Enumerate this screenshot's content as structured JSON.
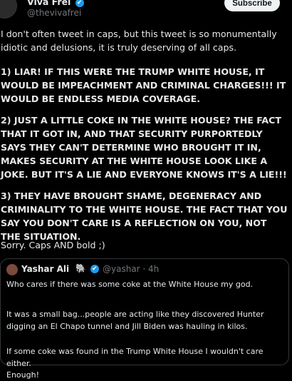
{
  "author": {
    "name": "Viva Frei",
    "verified_badge": "✔",
    "handle": "@thevivafrei",
    "subscribe_label": "Subscribe"
  },
  "tweet": {
    "p1": "I don't often tweet in caps, but this tweet is so monumentally idiotic and delusions, it is truly deserving of all caps.",
    "p2": "1) LIAR! IF THIS WERE THE TRUMP WHITE HOUSE, IT WOULD BE IMPEACHMENT AND CRIMINAL CHARGES!!! IT WOULD BE ENDLESS MEDIA COVERAGE.",
    "p3": "2) JUST A LITTLE COKE IN THE WHITE HOUSE? THE FACT THAT IT GOT IN, AND THAT SECURITY PURPORTEDLY SAYS THEY CAN'T DETERMINE WHO BROUGHT IT IN, MAKES SECURITY AT THE WHITE HOUSE LOOK LIKE A JOKE. BUT IT'S A LIE AND EVERYONE KNOWS IT'S A LIE!!!",
    "p4": "3) THEY HAVE BROUGHT SHAME, DEGENERACY AND CRIMINALITY TO THE WHITE HOUSE. THE FACT THAT YOU SAY YOU DON'T CARE IS A REFLECTION ON YOU, NOT THE SITUATION.",
    "p5": "Sorry. Caps AND bold ;)"
  },
  "quote": {
    "name": "Yashar Ali",
    "emoji": "🐘",
    "verified_badge": "✔",
    "handle_time": "@yashar · 4h",
    "lines": [
      "Who cares if there was some coke at the White House my god.",
      "It was a small bag...people are acting like they discovered Hunter digging an El Chapo tunnel and Jill Biden was hauling in kilos.",
      "If some coke was found in the Trump White House I wouldn't care either.",
      "Enough!"
    ]
  }
}
